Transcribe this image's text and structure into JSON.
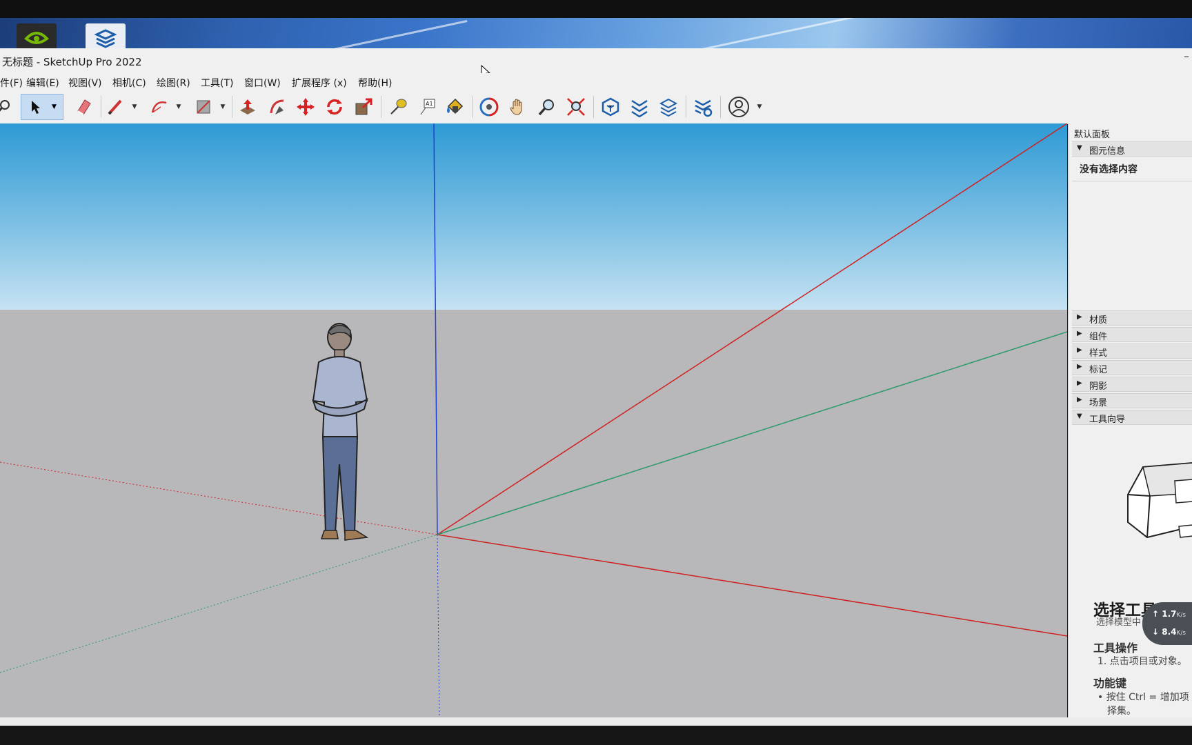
{
  "window": {
    "title": "无标题 - SketchUp Pro 2022",
    "minimize_glyph": "–"
  },
  "menu": [
    "件(F)",
    "编辑(E)",
    "视图(V)",
    "相机(C)",
    "绘图(R)",
    "工具(T)",
    "窗口(W)",
    "扩展程序 (x)",
    "帮助(H)"
  ],
  "toolbar": {
    "tools": [
      "zoom-icon",
      "select-icon",
      "eraser-icon",
      "pencil-icon",
      "arc-icon",
      "shape-icon",
      "push-pull-icon",
      "follow-me-icon",
      "move-icon",
      "rotate-icon",
      "scale-icon",
      "tape-measure-icon",
      "text-icon",
      "paint-bucket-icon",
      "orbit-icon",
      "pan-icon",
      "magnify-icon",
      "zoom-extents-icon",
      "warehouse-icon",
      "extension-warehouse-icon",
      "layout-icon",
      "extension-manager-icon",
      "account-icon"
    ],
    "active_tool": "select-icon"
  },
  "panel": {
    "header": "默认面板",
    "entity_info": {
      "title": "图元信息",
      "expanded": true,
      "content": "没有选择内容"
    },
    "sections": [
      {
        "title": "材质",
        "expanded": false
      },
      {
        "title": "组件",
        "expanded": false
      },
      {
        "title": "样式",
        "expanded": false
      },
      {
        "title": "标记",
        "expanded": false
      },
      {
        "title": "阴影",
        "expanded": false
      },
      {
        "title": "场景",
        "expanded": false
      },
      {
        "title": "工具向导",
        "expanded": true
      }
    ],
    "guide": {
      "title": "选择工具",
      "subtitle": "选择模型中",
      "operations_heading": "工具操作",
      "operation_1": "1. 点击项目或对象。",
      "keys_heading": "功能键",
      "key_1a": "• 按住 Ctrl = 增加项",
      "key_1b": "择集。"
    }
  },
  "network_speed": {
    "upload": "1.7",
    "download": "8.4",
    "unit": "K/s"
  },
  "colors": {
    "sky_top": "#2e9ad4",
    "ground": "#b8b8ba",
    "red_axis": "#d02020",
    "green_axis": "#2a9a6a",
    "blue_axis": "#1f3fd8",
    "active_tool_bg": "#c6dcf2"
  }
}
